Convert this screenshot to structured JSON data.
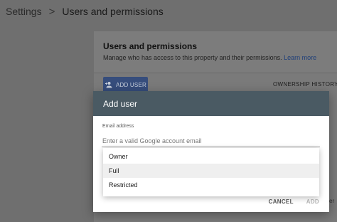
{
  "breadcrumb": {
    "root": "Settings",
    "separator": ">",
    "current": "Users and permissions"
  },
  "panel": {
    "title": "Users and permissions",
    "description": "Manage who has access to this property and their permissions.",
    "learn_more": "Learn more",
    "add_user_button": "ADD USER",
    "add_user_icon": "person-add-icon",
    "ownership_tab": "OWNERSHIP HISTORY"
  },
  "dialog": {
    "title": "Add user",
    "email_label": "Email address",
    "email_value": "",
    "email_placeholder": "Enter a valid Google account email",
    "role_options": [
      "Owner",
      "Full",
      "Restricted"
    ],
    "highlighted_option": "Full",
    "cancel_label": "CANCEL",
    "add_label": "ADD"
  },
  "background_partial_text": "er",
  "colors": {
    "overlay_bg": "#6f6f6f",
    "dialog_header": "#4a5a63",
    "primary_button": "#364d7c",
    "link": "#1f3f7a",
    "option_highlight": "#efefef"
  }
}
